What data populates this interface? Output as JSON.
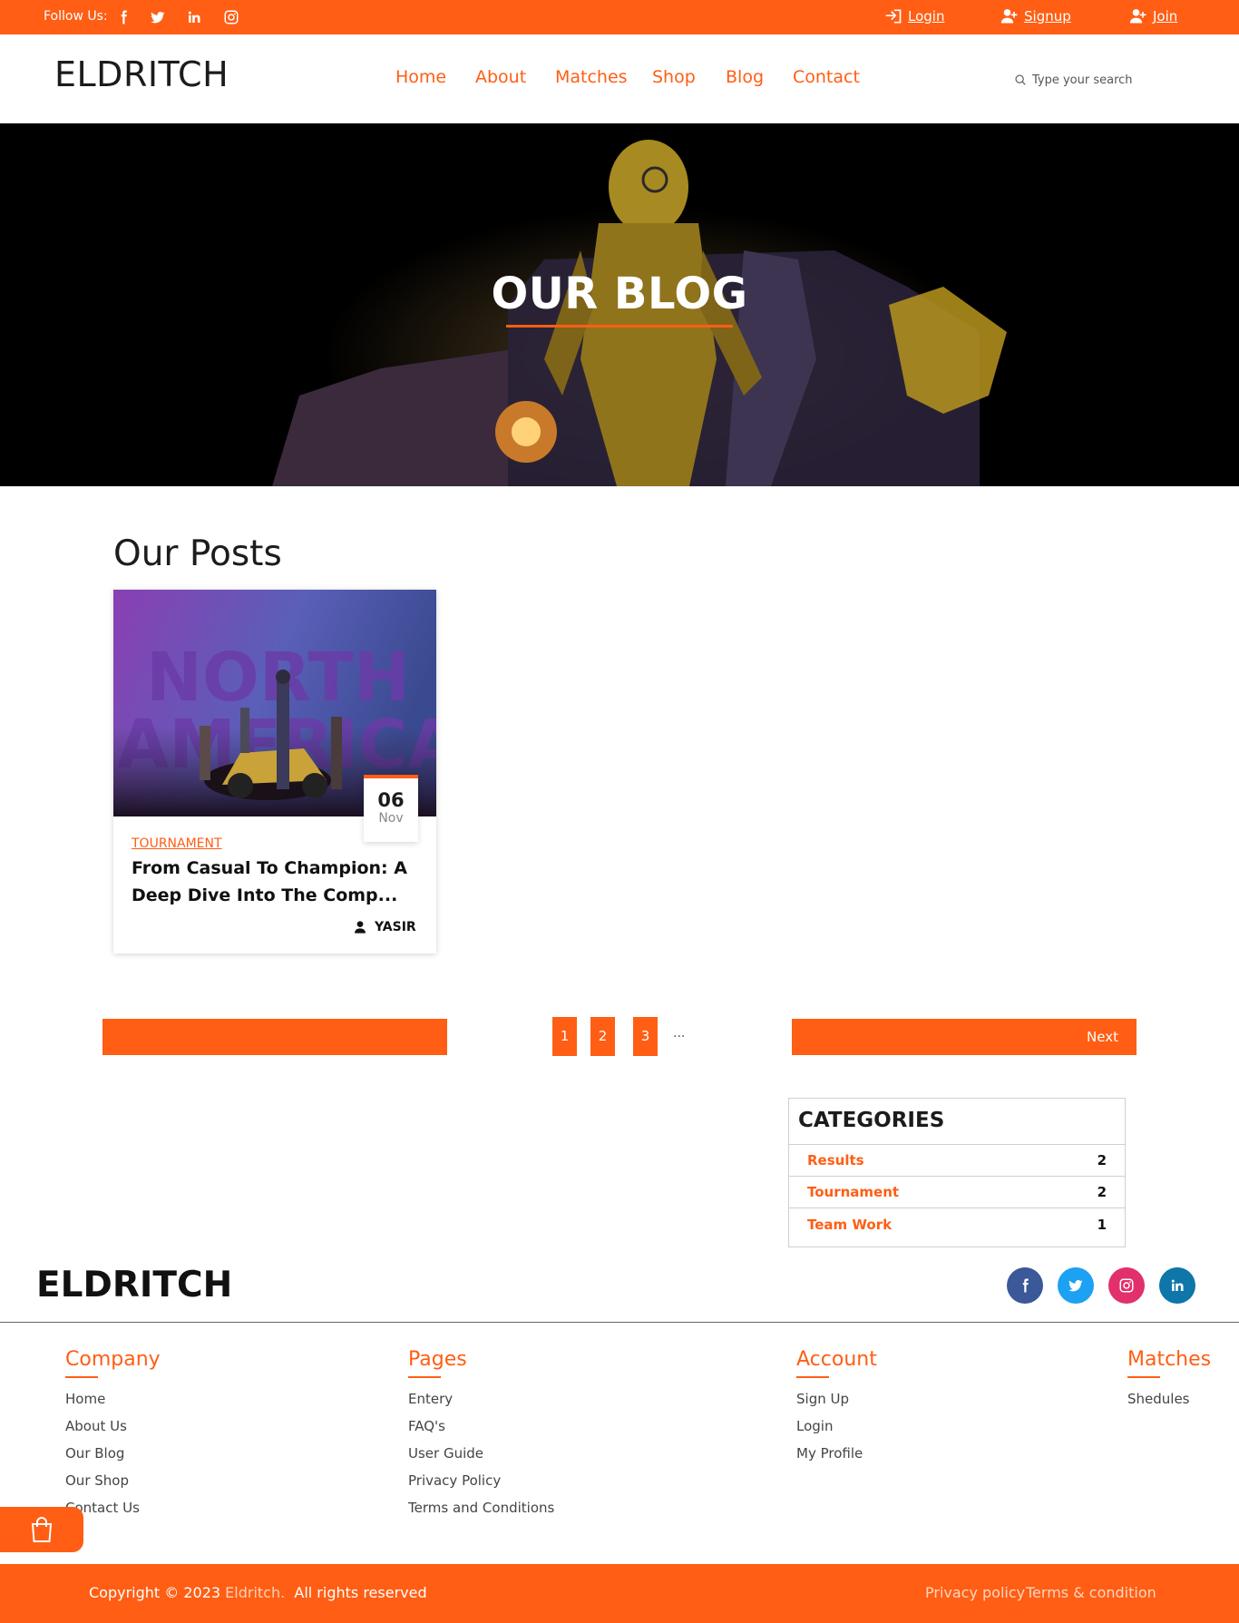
{
  "topbar": {
    "follow_label": "Follow Us:",
    "social_icons": [
      "facebook-icon",
      "twitter-icon",
      "linkedin-icon",
      "instagram-icon"
    ],
    "login": "Login",
    "signup": "Signup",
    "join": "Join"
  },
  "header": {
    "logo": "ELDRITCH",
    "nav": [
      "Home",
      "About",
      "Matches",
      "Shop",
      "Blog",
      "Contact"
    ],
    "search_placeholder": "Type your search"
  },
  "hero": {
    "title": "OUR BLOG"
  },
  "posts": {
    "heading": "Our Posts",
    "items": [
      {
        "day": "06",
        "month": "Nov",
        "category": "TOURNAMENT",
        "title": "From Casual To Champion: A Deep Dive Into The Comp...",
        "author": "YASIR",
        "image_text": [
          "NORTH",
          "AMERICA"
        ]
      }
    ]
  },
  "pagination": {
    "pages": [
      "1",
      "2",
      "3"
    ],
    "ellipsis": "...",
    "next": "Next"
  },
  "categories": {
    "title": "CATEGORIES",
    "items": [
      {
        "name": "Results",
        "count": "2"
      },
      {
        "name": "Tournament",
        "count": "2"
      },
      {
        "name": "Team Work",
        "count": "1"
      }
    ]
  },
  "footer": {
    "logo": "ELDRITCH",
    "social_icons": [
      "facebook-icon",
      "twitter-icon",
      "instagram-icon",
      "linkedin-icon"
    ],
    "columns": [
      {
        "title": "Company",
        "links": [
          "Home",
          "About Us",
          "Our Blog",
          "Our Shop",
          "Contact Us"
        ]
      },
      {
        "title": "Pages",
        "links": [
          "Entery",
          "FAQ's",
          "User Guide",
          "Privacy Policy",
          "Terms and Conditions"
        ]
      },
      {
        "title": "Account",
        "links": [
          "Sign Up",
          "Login",
          "My Profile"
        ]
      },
      {
        "title": "Matches",
        "links": [
          "Shedules"
        ]
      }
    ],
    "copyright_prefix": "Copyright © 2023",
    "copyright_brand": "Eldritch.",
    "copyright_suffix": "All rights reserved",
    "privacy": "Privacy policy",
    "terms": "Terms & condition"
  },
  "colors": {
    "accent": "#ff5e14",
    "facebook": "#3b5998",
    "twitter": "#1da1f2",
    "instagram": "#e1306c",
    "linkedin": "#0e76a8"
  }
}
